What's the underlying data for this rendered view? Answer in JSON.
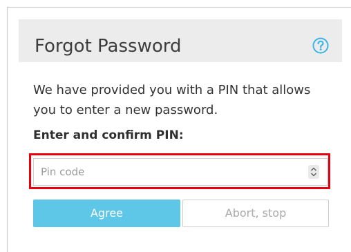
{
  "dialog": {
    "title": "Forgot Password",
    "help_icon": "question-circle-icon",
    "description": "We have provided you with a PIN that allows you to enter a new password.",
    "pin_label": "Enter and confirm PIN:",
    "pin_input": {
      "placeholder": "Pin code",
      "value": ""
    },
    "agree_label": "Agree",
    "abort_label": "Abort, stop"
  },
  "colors": {
    "accent": "#5ec7e8",
    "help_icon": "#3cb4e6",
    "highlight": "#e8000c",
    "header_bg": "#ececec"
  }
}
